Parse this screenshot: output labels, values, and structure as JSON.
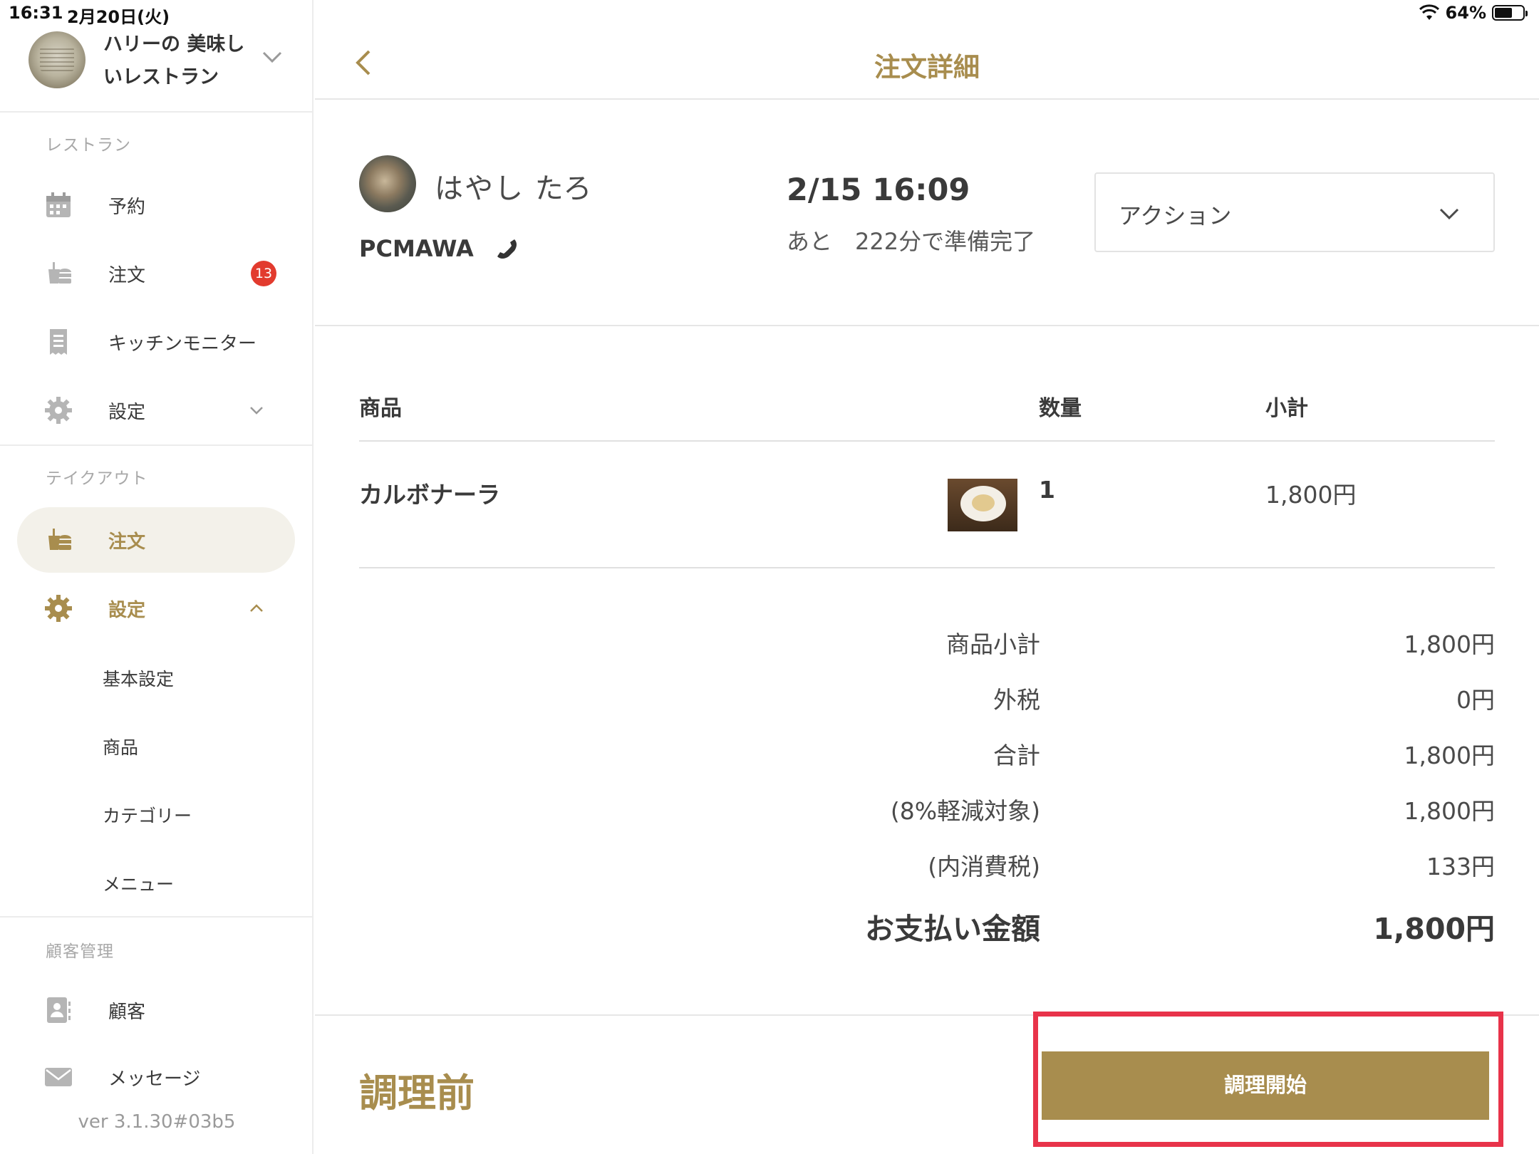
{
  "status_bar": {
    "time": "16:31",
    "date": "2月20日(火)",
    "battery": "64%",
    "battery_level": 0.64
  },
  "sidebar": {
    "shop_name_line1": "ハリーの 美味し",
    "shop_name_line2": "いレストラン",
    "sections": {
      "restaurant": "レストラン",
      "takeout": "テイクアウト",
      "customer": "顧客管理"
    },
    "restaurant_items": [
      {
        "label": "予約",
        "icon": "calendar-icon"
      },
      {
        "label": "注文",
        "icon": "order-icon",
        "badge": "13"
      },
      {
        "label": "キッチンモニター",
        "icon": "receipt-icon"
      },
      {
        "label": "設定",
        "icon": "gear-icon"
      }
    ],
    "takeout_items": [
      {
        "label": "注文",
        "icon": "order-icon"
      },
      {
        "label": "設定",
        "icon": "gear-icon"
      }
    ],
    "takeout_settings_sub": [
      "基本設定",
      "商品",
      "カテゴリー",
      "メニュー"
    ],
    "customer_items": [
      {
        "label": "顧客",
        "icon": "contact-icon"
      },
      {
        "label": "メッセージ",
        "icon": "mail-icon"
      }
    ],
    "version": "ver 3.1.30#03b5"
  },
  "header": {
    "title": "注文詳細"
  },
  "order": {
    "customer_name": "はやし たろ",
    "customer_code": "PCMAWA",
    "time": "2/15 16:09",
    "ready_text": "あと　222分で準備完了",
    "action_label": "アクション"
  },
  "items_table": {
    "headers": {
      "product": "商品",
      "quantity": "数量",
      "subtotal": "小計"
    },
    "rows": [
      {
        "name": "カルボナーラ",
        "quantity": "1",
        "subtotal": "1,800円"
      }
    ]
  },
  "summary": [
    {
      "label": "商品小計",
      "value": "1,800円"
    },
    {
      "label": "外税",
      "value": "0円"
    },
    {
      "label": "合計",
      "value": "1,800円"
    },
    {
      "label": "(8%軽減対象)",
      "value": "1,800円"
    },
    {
      "label": "(内消費税)",
      "value": "133円"
    },
    {
      "label": "お支払い金額",
      "value": "1,800円"
    }
  ],
  "footer": {
    "status": "調理前",
    "start_button": "調理開始"
  },
  "colors": {
    "accent": "#a88d4e",
    "badge": "#e23b2e",
    "highlight": "#e8334a"
  }
}
